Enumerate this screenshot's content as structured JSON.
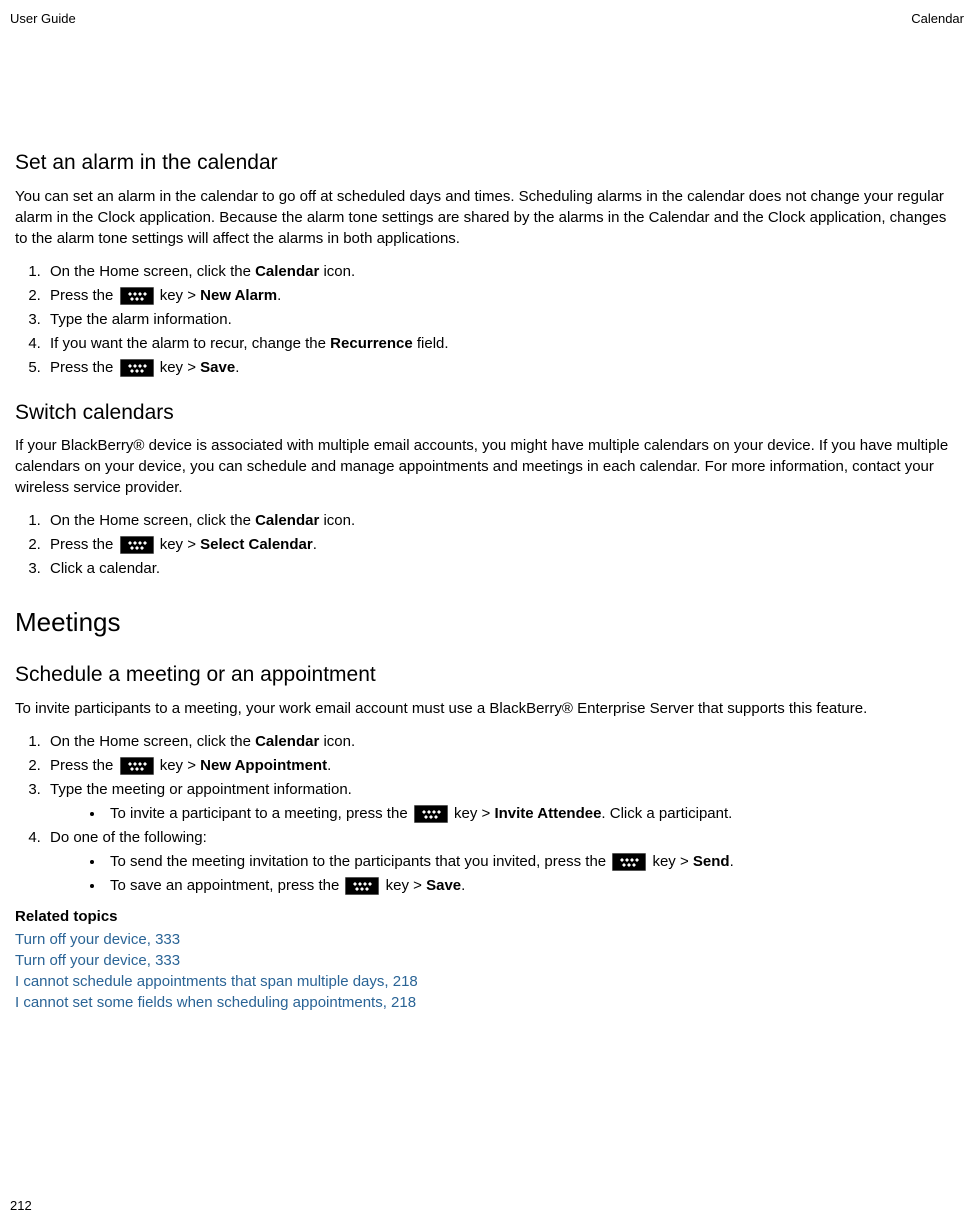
{
  "header": {
    "left": "User Guide",
    "right": "Calendar"
  },
  "section1": {
    "title": "Set an alarm in the calendar",
    "intro": "You can set an alarm in the calendar to go off at scheduled days and times. Scheduling alarms in the calendar does not change your regular alarm in the Clock application. Because the alarm tone settings are shared by the alarms in the Calendar and the Clock application, changes to the alarm tone settings will affect the alarms in both applications.",
    "step1_pre": "On the Home screen, click the ",
    "step1_bold": "Calendar",
    "step1_post": " icon.",
    "step2_pre": "Press the ",
    "step2_mid": " key > ",
    "step2_bold": "New Alarm",
    "step2_post": ".",
    "step3": "Type the alarm information.",
    "step4_pre": "If you want the alarm to recur, change the ",
    "step4_bold": "Recurrence",
    "step4_post": " field.",
    "step5_pre": "Press the ",
    "step5_mid": " key > ",
    "step5_bold": "Save",
    "step5_post": "."
  },
  "section2": {
    "title": "Switch calendars",
    "intro": "If your BlackBerry® device is associated with multiple email accounts, you might have multiple calendars on your device. If you have multiple calendars on your device, you can schedule and manage appointments and meetings in each calendar. For more information, contact your wireless service provider.",
    "step1_pre": "On the Home screen, click the ",
    "step1_bold": "Calendar",
    "step1_post": " icon.",
    "step2_pre": "Press the ",
    "step2_mid": " key > ",
    "step2_bold": "Select Calendar",
    "step2_post": ".",
    "step3": "Click a calendar."
  },
  "section3": {
    "title": "Meetings"
  },
  "section4": {
    "title": "Schedule a meeting or an appointment",
    "intro": "To invite participants to a meeting, your work email account must use a BlackBerry® Enterprise Server that supports this feature.",
    "step1_pre": "On the Home screen, click the ",
    "step1_bold": "Calendar",
    "step1_post": " icon.",
    "step2_pre": "Press the ",
    "step2_mid": " key > ",
    "step2_bold": "New Appointment",
    "step2_post": ".",
    "step3": "Type the meeting or appointment information.",
    "step3b1_pre": "To invite a participant to a meeting, press the ",
    "step3b1_mid": " key > ",
    "step3b1_bold": "Invite Attendee",
    "step3b1_post": ". Click a participant.",
    "step4": "Do one of the following:",
    "step4b1_pre": "To send the meeting invitation to the participants that you invited, press the ",
    "step4b1_mid": " key > ",
    "step4b1_bold": "Send",
    "step4b1_post": ".",
    "step4b2_pre": "To save an appointment, press the ",
    "step4b2_mid": " key > ",
    "step4b2_bold": "Save",
    "step4b2_post": "."
  },
  "related": {
    "heading": "Related topics",
    "links": [
      "Turn off your device, 333",
      "Turn off your device, 333",
      "I cannot schedule appointments that span multiple days, 218",
      "I cannot set some fields when scheduling appointments, 218"
    ]
  },
  "page_number": "212"
}
